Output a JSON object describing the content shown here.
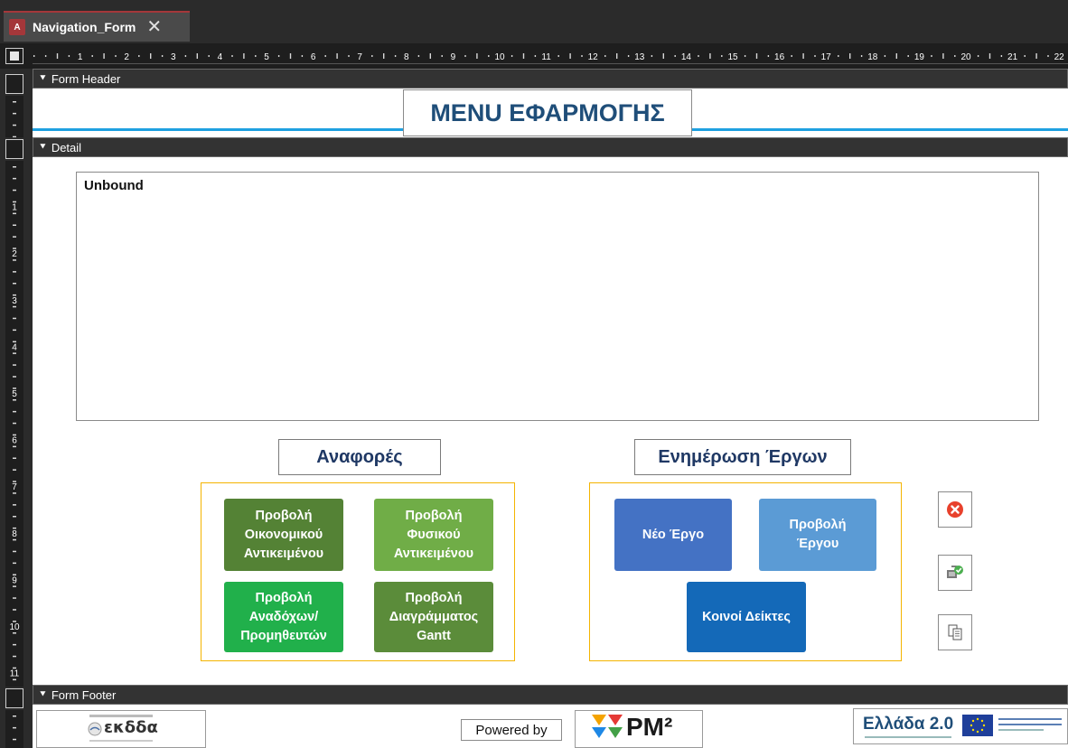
{
  "window": {
    "tab_title": "Navigation_Form",
    "app_icon_letter": "A",
    "close_glyph": "✕"
  },
  "ruler": {
    "labels": [
      "1",
      "2",
      "3",
      "4",
      "5",
      "6",
      "7",
      "8",
      "9",
      "10",
      "11",
      "12",
      "13",
      "14",
      "15",
      "16",
      "17",
      "18",
      "19",
      "20",
      "21",
      "22"
    ],
    "vertical_labels": [
      "1",
      "2",
      "3",
      "4",
      "5",
      "6",
      "7",
      "8",
      "9",
      "10",
      "11"
    ]
  },
  "sections": {
    "form_header": "Form Header",
    "detail": "Detail",
    "form_footer": "Form Footer",
    "bar_icon": "⯆"
  },
  "header": {
    "title": "MENU ΕΦΑΡΜΟΓΗΣ"
  },
  "detail": {
    "subform_label": "Unbound",
    "reports_label": "Αναφορές",
    "updates_label": "Ενημέρωση Έργων",
    "report_buttons": [
      {
        "label": "Προβολή\nΟικονομικού\nΑντικειμένου",
        "color": "#548235"
      },
      {
        "label": "Προβολή\nΦυσικού\nΑντικειμένου",
        "color": "#70ad47"
      },
      {
        "label": "Προβολή\nΑναδόχων/\nΠρομηθευτών",
        "color": "#21b04b"
      },
      {
        "label": "Προβολή\nΔιαγράμματος\nGantt",
        "color": "#5b8c3a"
      }
    ],
    "project_buttons": [
      {
        "label": "Νέο Έργο",
        "color": "#4472c4"
      },
      {
        "label": "Προβολή\nΈργου",
        "color": "#5b9bd5"
      },
      {
        "label": "Κοινοί Δείκτες",
        "color": "#1469b8"
      }
    ],
    "side_icons": [
      "close-circle-icon",
      "transfer-check-icon",
      "copy-icon"
    ]
  },
  "footer": {
    "powered_by": "Powered by",
    "pm2_text": "PM²",
    "left_logo_text": "εκδδα",
    "right_logo_text": "Ελλάδα 2.0"
  },
  "colors": {
    "title": "#1f4e79",
    "accent_line": "#1ea0e0",
    "frame": "#f4b400",
    "close_red": "#e8412c"
  }
}
